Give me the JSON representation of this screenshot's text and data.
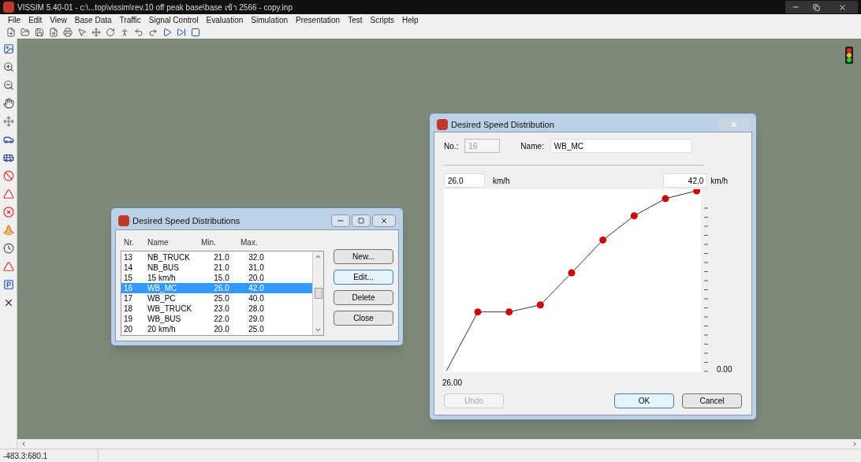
{
  "window": {
    "title": "VISSIM 5.40-01 - c:\\...top\\vissim\\rev.10  off peak base\\base เข้า 2566 - copy.inp"
  },
  "menu": [
    {
      "label": "File"
    },
    {
      "label": "Edit"
    },
    {
      "label": "View"
    },
    {
      "label": "Base Data"
    },
    {
      "label": "Traffic"
    },
    {
      "label": "Signal Control"
    },
    {
      "label": "Evaluation"
    },
    {
      "label": "Simulation"
    },
    {
      "label": "Presentation"
    },
    {
      "label": "Test"
    },
    {
      "label": "Scripts"
    },
    {
      "label": "Help"
    }
  ],
  "list_dialog": {
    "title": "Desired Speed Distributions",
    "columns": [
      "Nr.",
      "Name",
      "Min.",
      "Max."
    ],
    "rows": [
      {
        "nr": "13",
        "name": "NB_TRUCK",
        "min": "21.0",
        "max": "32.0",
        "selected": false
      },
      {
        "nr": "14",
        "name": "NB_BUS",
        "min": "21.0",
        "max": "31.0",
        "selected": false
      },
      {
        "nr": "15",
        "name": "15 km/h",
        "min": "15.0",
        "max": "20.0",
        "selected": false
      },
      {
        "nr": "16",
        "name": "WB_MC",
        "min": "26.0",
        "max": "42.0",
        "selected": true
      },
      {
        "nr": "17",
        "name": "WB_PC",
        "min": "25.0",
        "max": "40.0",
        "selected": false
      },
      {
        "nr": "18",
        "name": "WB_TRUCK",
        "min": "23.0",
        "max": "28.0",
        "selected": false
      },
      {
        "nr": "19",
        "name": "WB_BUS",
        "min": "22.0",
        "max": "29.0",
        "selected": false
      },
      {
        "nr": "20",
        "name": "20 km/h",
        "min": "20.0",
        "max": "25.0",
        "selected": false
      }
    ],
    "buttons": [
      {
        "label": "New...",
        "focused": false
      },
      {
        "label": "Edit...",
        "focused": true
      },
      {
        "label": "Delete",
        "focused": false
      },
      {
        "label": "Close",
        "focused": false
      }
    ]
  },
  "speed_dialog": {
    "title": "Desired Speed Distribution",
    "no_label": "No.:",
    "no_value": "16",
    "name_label": "Name:",
    "name_value": "WB_MC",
    "min_value": "26.0",
    "min_unit": "km/h",
    "max_value": "42.0",
    "max_unit": "km/h",
    "x_start_label": "26.00",
    "y_label": "0.00",
    "buttons": [
      {
        "label": "Undo",
        "disabled": true,
        "focused": false
      },
      {
        "label": "OK",
        "disabled": false,
        "focused": true
      },
      {
        "label": "Cancel",
        "disabled": false,
        "focused": false
      }
    ]
  },
  "status_bar": {
    "coordinates": "-483.3:680.1"
  }
}
